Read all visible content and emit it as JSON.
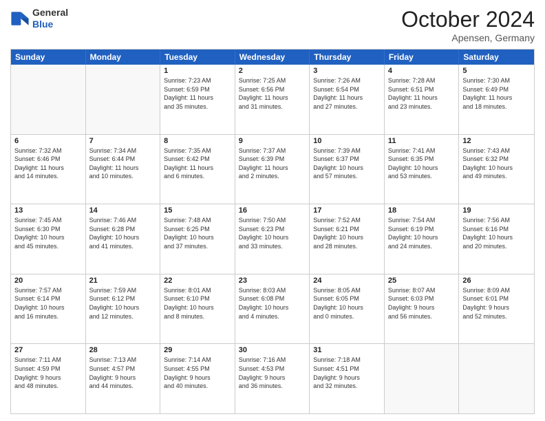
{
  "header": {
    "logo_general": "General",
    "logo_blue": "Blue",
    "month_title": "October 2024",
    "location": "Apensen, Germany"
  },
  "days_of_week": [
    "Sunday",
    "Monday",
    "Tuesday",
    "Wednesday",
    "Thursday",
    "Friday",
    "Saturday"
  ],
  "rows": [
    [
      {
        "day": "",
        "lines": [],
        "empty": true
      },
      {
        "day": "",
        "lines": [],
        "empty": true
      },
      {
        "day": "1",
        "lines": [
          "Sunrise: 7:23 AM",
          "Sunset: 6:59 PM",
          "Daylight: 11 hours",
          "and 35 minutes."
        ]
      },
      {
        "day": "2",
        "lines": [
          "Sunrise: 7:25 AM",
          "Sunset: 6:56 PM",
          "Daylight: 11 hours",
          "and 31 minutes."
        ]
      },
      {
        "day": "3",
        "lines": [
          "Sunrise: 7:26 AM",
          "Sunset: 6:54 PM",
          "Daylight: 11 hours",
          "and 27 minutes."
        ]
      },
      {
        "day": "4",
        "lines": [
          "Sunrise: 7:28 AM",
          "Sunset: 6:51 PM",
          "Daylight: 11 hours",
          "and 23 minutes."
        ]
      },
      {
        "day": "5",
        "lines": [
          "Sunrise: 7:30 AM",
          "Sunset: 6:49 PM",
          "Daylight: 11 hours",
          "and 18 minutes."
        ]
      }
    ],
    [
      {
        "day": "6",
        "lines": [
          "Sunrise: 7:32 AM",
          "Sunset: 6:46 PM",
          "Daylight: 11 hours",
          "and 14 minutes."
        ]
      },
      {
        "day": "7",
        "lines": [
          "Sunrise: 7:34 AM",
          "Sunset: 6:44 PM",
          "Daylight: 11 hours",
          "and 10 minutes."
        ]
      },
      {
        "day": "8",
        "lines": [
          "Sunrise: 7:35 AM",
          "Sunset: 6:42 PM",
          "Daylight: 11 hours",
          "and 6 minutes."
        ]
      },
      {
        "day": "9",
        "lines": [
          "Sunrise: 7:37 AM",
          "Sunset: 6:39 PM",
          "Daylight: 11 hours",
          "and 2 minutes."
        ]
      },
      {
        "day": "10",
        "lines": [
          "Sunrise: 7:39 AM",
          "Sunset: 6:37 PM",
          "Daylight: 10 hours",
          "and 57 minutes."
        ]
      },
      {
        "day": "11",
        "lines": [
          "Sunrise: 7:41 AM",
          "Sunset: 6:35 PM",
          "Daylight: 10 hours",
          "and 53 minutes."
        ]
      },
      {
        "day": "12",
        "lines": [
          "Sunrise: 7:43 AM",
          "Sunset: 6:32 PM",
          "Daylight: 10 hours",
          "and 49 minutes."
        ]
      }
    ],
    [
      {
        "day": "13",
        "lines": [
          "Sunrise: 7:45 AM",
          "Sunset: 6:30 PM",
          "Daylight: 10 hours",
          "and 45 minutes."
        ]
      },
      {
        "day": "14",
        "lines": [
          "Sunrise: 7:46 AM",
          "Sunset: 6:28 PM",
          "Daylight: 10 hours",
          "and 41 minutes."
        ]
      },
      {
        "day": "15",
        "lines": [
          "Sunrise: 7:48 AM",
          "Sunset: 6:25 PM",
          "Daylight: 10 hours",
          "and 37 minutes."
        ]
      },
      {
        "day": "16",
        "lines": [
          "Sunrise: 7:50 AM",
          "Sunset: 6:23 PM",
          "Daylight: 10 hours",
          "and 33 minutes."
        ]
      },
      {
        "day": "17",
        "lines": [
          "Sunrise: 7:52 AM",
          "Sunset: 6:21 PM",
          "Daylight: 10 hours",
          "and 28 minutes."
        ]
      },
      {
        "day": "18",
        "lines": [
          "Sunrise: 7:54 AM",
          "Sunset: 6:19 PM",
          "Daylight: 10 hours",
          "and 24 minutes."
        ]
      },
      {
        "day": "19",
        "lines": [
          "Sunrise: 7:56 AM",
          "Sunset: 6:16 PM",
          "Daylight: 10 hours",
          "and 20 minutes."
        ]
      }
    ],
    [
      {
        "day": "20",
        "lines": [
          "Sunrise: 7:57 AM",
          "Sunset: 6:14 PM",
          "Daylight: 10 hours",
          "and 16 minutes."
        ]
      },
      {
        "day": "21",
        "lines": [
          "Sunrise: 7:59 AM",
          "Sunset: 6:12 PM",
          "Daylight: 10 hours",
          "and 12 minutes."
        ]
      },
      {
        "day": "22",
        "lines": [
          "Sunrise: 8:01 AM",
          "Sunset: 6:10 PM",
          "Daylight: 10 hours",
          "and 8 minutes."
        ]
      },
      {
        "day": "23",
        "lines": [
          "Sunrise: 8:03 AM",
          "Sunset: 6:08 PM",
          "Daylight: 10 hours",
          "and 4 minutes."
        ]
      },
      {
        "day": "24",
        "lines": [
          "Sunrise: 8:05 AM",
          "Sunset: 6:05 PM",
          "Daylight: 10 hours",
          "and 0 minutes."
        ]
      },
      {
        "day": "25",
        "lines": [
          "Sunrise: 8:07 AM",
          "Sunset: 6:03 PM",
          "Daylight: 9 hours",
          "and 56 minutes."
        ]
      },
      {
        "day": "26",
        "lines": [
          "Sunrise: 8:09 AM",
          "Sunset: 6:01 PM",
          "Daylight: 9 hours",
          "and 52 minutes."
        ]
      }
    ],
    [
      {
        "day": "27",
        "lines": [
          "Sunrise: 7:11 AM",
          "Sunset: 4:59 PM",
          "Daylight: 9 hours",
          "and 48 minutes."
        ]
      },
      {
        "day": "28",
        "lines": [
          "Sunrise: 7:13 AM",
          "Sunset: 4:57 PM",
          "Daylight: 9 hours",
          "and 44 minutes."
        ]
      },
      {
        "day": "29",
        "lines": [
          "Sunrise: 7:14 AM",
          "Sunset: 4:55 PM",
          "Daylight: 9 hours",
          "and 40 minutes."
        ]
      },
      {
        "day": "30",
        "lines": [
          "Sunrise: 7:16 AM",
          "Sunset: 4:53 PM",
          "Daylight: 9 hours",
          "and 36 minutes."
        ]
      },
      {
        "day": "31",
        "lines": [
          "Sunrise: 7:18 AM",
          "Sunset: 4:51 PM",
          "Daylight: 9 hours",
          "and 32 minutes."
        ]
      },
      {
        "day": "",
        "lines": [],
        "empty": true
      },
      {
        "day": "",
        "lines": [],
        "empty": true
      }
    ]
  ]
}
